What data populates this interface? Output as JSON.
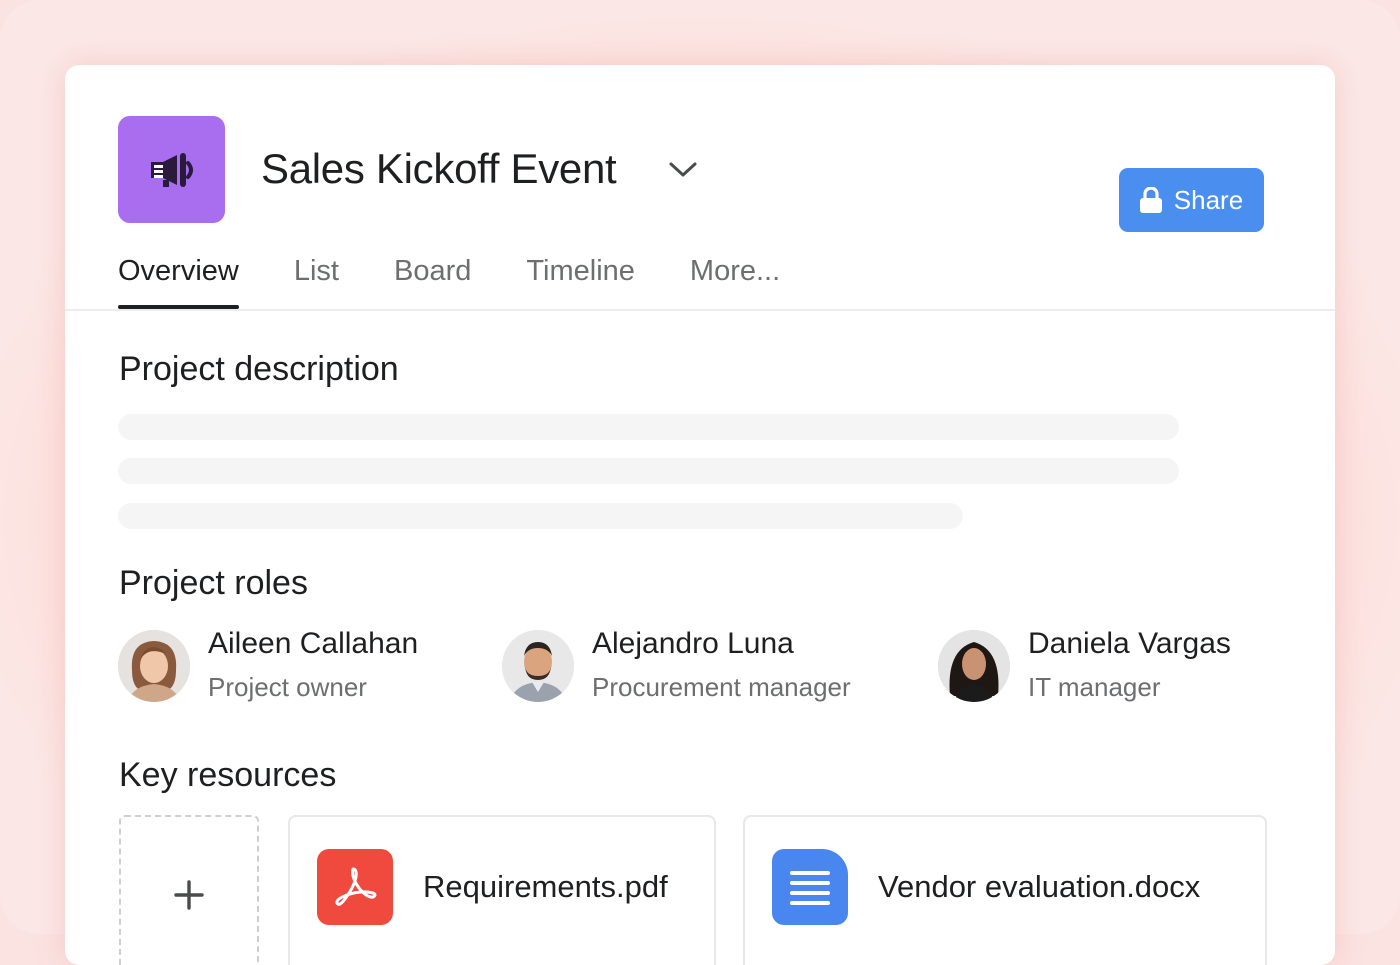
{
  "project": {
    "title": "Sales Kickoff Event",
    "icon": "megaphone-icon",
    "icon_color": "#a96df0"
  },
  "share": {
    "label": "Share",
    "icon": "lock-icon",
    "color": "#4a8ff0"
  },
  "tabs": [
    {
      "label": "Overview",
      "active": true
    },
    {
      "label": "List",
      "active": false
    },
    {
      "label": "Board",
      "active": false
    },
    {
      "label": "Timeline",
      "active": false
    },
    {
      "label": "More...",
      "active": false
    }
  ],
  "sections": {
    "description": "Project description",
    "roles": "Project roles",
    "resources": "Key resources"
  },
  "roles": [
    {
      "name": "Aileen Callahan",
      "title": "Project owner"
    },
    {
      "name": "Alejandro Luna",
      "title": "Procurement manager"
    },
    {
      "name": "Daniela Vargas",
      "title": "IT manager"
    }
  ],
  "resources": [
    {
      "name": "Requirements.pdf",
      "icon": "pdf-icon",
      "color": "#f0493e"
    },
    {
      "name": "Vendor evaluation.docx",
      "icon": "document-icon",
      "color": "#4a86f0"
    }
  ]
}
